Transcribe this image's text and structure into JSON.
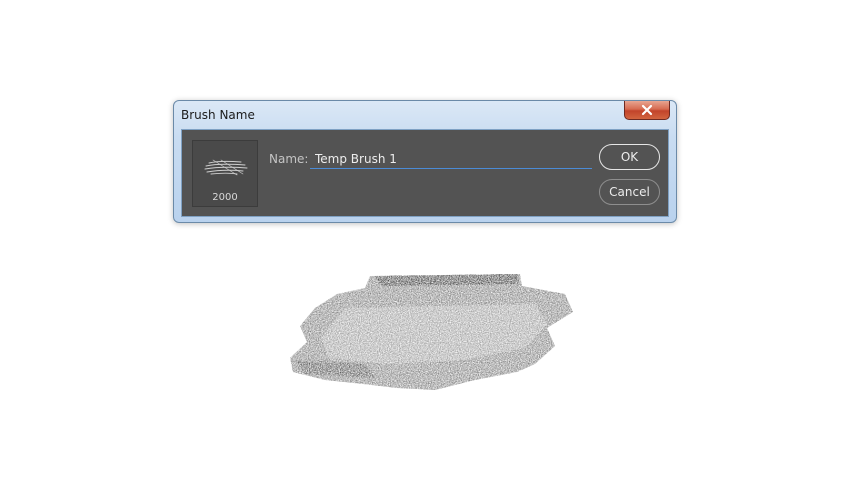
{
  "dialog": {
    "title": "Brush Name",
    "close_icon": "close-icon",
    "thumbnail": {
      "size_label": "2000"
    },
    "name_label": "Name:",
    "name_value": "Temp Brush 1",
    "ok_label": "OK",
    "cancel_label": "Cancel"
  },
  "colors": {
    "dialog_background": "#535353",
    "input_underline": "#4b8bd6",
    "close_button": "#c2432b"
  }
}
